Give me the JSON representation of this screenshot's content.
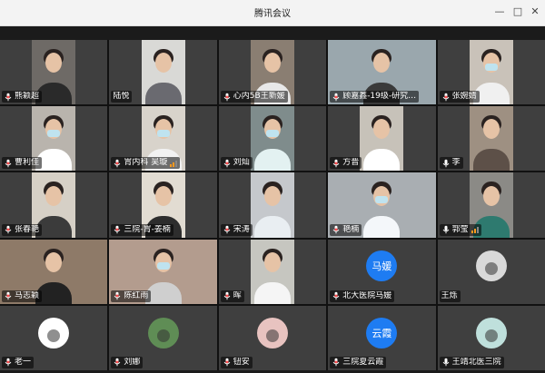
{
  "window": {
    "title": "腾讯会议",
    "minimize": "—",
    "maximize": "□",
    "close": "✕"
  },
  "participants": [
    {
      "name": "熊颖超",
      "type": "video",
      "bg": "#6e6a66",
      "body": "#2a2a2a",
      "mic": "on"
    },
    {
      "name": "陆悦",
      "type": "video",
      "bg": "#d9d9d6",
      "body": "#6a6a70",
      "mic": "none"
    },
    {
      "name": "心内5B王新媛",
      "type": "video",
      "bg": "#8a7e72",
      "body": "#e8e8e8",
      "mic": "on"
    },
    {
      "name": "顾嘉鑫-19级-研究…",
      "type": "video",
      "wide": true,
      "bg": "#9aa7ad",
      "body": "#3a3a3a",
      "mic": "on"
    },
    {
      "name": "张婉婧",
      "type": "video",
      "bg": "#c9c2b9",
      "body": "#f0f0f0",
      "mic": "on",
      "masked": true
    },
    {
      "name": "曹利佳",
      "type": "video",
      "bg": "#b9b4ad",
      "body": "#ffffff",
      "mic": "on",
      "masked": true
    },
    {
      "name": "胃内科 吴璇",
      "type": "video",
      "bg": "#d8d3cb",
      "body": "#f2f2f2",
      "mic": "on",
      "masked": true,
      "signal": true
    },
    {
      "name": "刘灿",
      "type": "video",
      "bg": "#7f8c8c",
      "body": "#e3f1f1",
      "mic": "on",
      "masked": true
    },
    {
      "name": "方晋",
      "type": "video",
      "bg": "#c7c2b9",
      "body": "#ffffff",
      "mic": "on"
    },
    {
      "name": "李",
      "type": "video",
      "bg": "#9e9082",
      "body": "#5d5048",
      "mic": "muted"
    },
    {
      "name": "张春艳",
      "type": "video",
      "bg": "#d6d0c6",
      "body": "#3b3b3b",
      "mic": "on"
    },
    {
      "name": "三院-胃-姜楠",
      "type": "video",
      "bg": "#e2dcd2",
      "body": "#2d2d2d",
      "mic": "on"
    },
    {
      "name": "宋涛",
      "type": "video",
      "bg": "#c5c8cc",
      "body": "#e9eef2",
      "mic": "on"
    },
    {
      "name": "艳楠",
      "type": "video",
      "wide": true,
      "bg": "#a9aeb2",
      "body": "#f4f7fa",
      "mic": "on",
      "masked": true
    },
    {
      "name": "郭莹",
      "type": "video",
      "bg": "#8b8a86",
      "body": "#2e7a6f",
      "mic": "muted",
      "signal": true
    },
    {
      "name": "马志颖",
      "type": "video",
      "wide": true,
      "bg": "#8e7a68",
      "body": "#222222",
      "mic": "on"
    },
    {
      "name": "陈红雨",
      "type": "video",
      "wide": true,
      "bg": "#b39c8e",
      "body": "#cfcfcf",
      "mic": "on",
      "masked": true
    },
    {
      "name": "晖",
      "type": "video",
      "bg": "#c6c6c0",
      "body": "#f5f5f5",
      "mic": "on"
    },
    {
      "name": "北大医院马媛",
      "type": "avatar",
      "text": "马媛",
      "mic": "on"
    },
    {
      "name": "王烁",
      "type": "avatar-img",
      "avatar_bg": "#d9d9d9",
      "mic": "none"
    },
    {
      "name": "老一",
      "type": "avatar-img",
      "avatar_bg": "#ffffff",
      "mic": "on"
    },
    {
      "name": "刘娜",
      "type": "avatar-img",
      "avatar_bg": "#5f8d55",
      "mic": "on"
    },
    {
      "name": "钮安",
      "type": "avatar-img",
      "avatar_bg": "#e8c3c0",
      "mic": "on"
    },
    {
      "name": "三院夏云霞",
      "type": "avatar",
      "text": "云霞",
      "mic": "on"
    },
    {
      "name": "王靖北医三院",
      "type": "avatar-img",
      "avatar_bg": "#bfe0dc",
      "mic": "muted"
    }
  ],
  "colors": {
    "avatar_blue": "#1e7cf2",
    "mic_on": "#ff4d4f",
    "tile": "#3f3f3f",
    "signal": "#ff9a1f"
  }
}
